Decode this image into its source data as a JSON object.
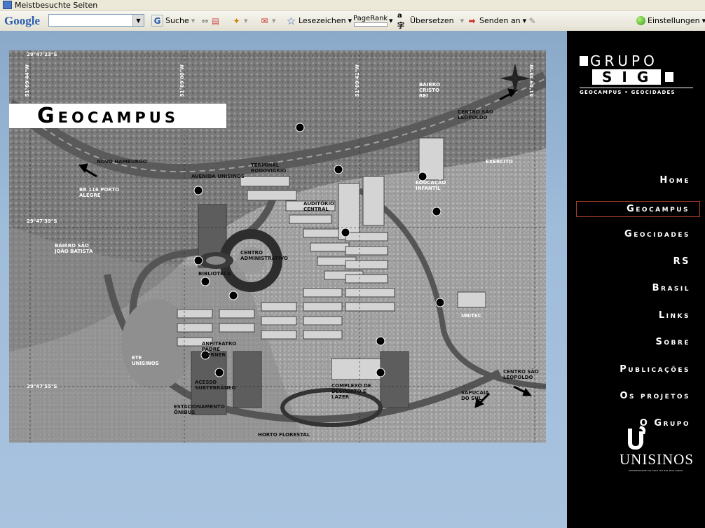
{
  "bookmarks_bar": {
    "item": "Meistbesuchte Seiten"
  },
  "google_toolbar": {
    "logo": "Google",
    "search_value": "",
    "search_label": "Suche",
    "bookmarks_label": "Lesezeichen",
    "pagerank_label": "PageRank",
    "translate_label": "Übersetzen",
    "send_label": "Senden an",
    "settings_label": "Einstellungen"
  },
  "brand": {
    "grupo": "GRUPO",
    "sig": "SIG",
    "subtitle": "GEOCAMPUS • GEOCIDADES"
  },
  "nav": {
    "home": "Home",
    "geocampus": "Geocampus",
    "geocidades": "Geocidades",
    "rs": "RS",
    "brasil": "Brasil",
    "links": "Links",
    "sobre": "Sobre",
    "publicacoes": "Publicações",
    "os_projetos": "Os projetos",
    "o_grupo": "O Grupo"
  },
  "university": {
    "name": "UNISINOS",
    "tagline": "UNIVERSIDADE DO VALE DO RIO DOS SINOS"
  },
  "map": {
    "title": "Geocampus",
    "coords": {
      "top_left": "29°47'23\"S",
      "mid_left": "29°47'39\"S",
      "bottom_left": "29°47'55\"S",
      "lon1": "51°09'44\"W",
      "lon2": "51°09'00\"W",
      "lon3": "51°09'41\"W",
      "lon4": "51°09'35\"W"
    },
    "labels": {
      "centro_administrativo": "CENTRO ADMINISTRATIVO",
      "novo_hamburgo": "NOVO HAMBURGO",
      "centro_sao_leopoldo": "CENTRO SÃO LEOPOLDO",
      "br116": "BR 116 PORTO ALEGRE",
      "complexo": "COMPLEXO DE DESPORTO E LAZER",
      "avenida": "AVENIDA UNISINOS",
      "bairro_sao_joao": "BAIRRO SÃO JOÃO BATISTA",
      "bairro_cristo_rei": "BAIRRO CRISTO REI",
      "exercito": "EXÉRCITO",
      "ete": "ETE UNISINOS",
      "estacionamento": "ESTACIONAMENTO ÔNIBUS",
      "horto": "HORTO FLORESTAL",
      "sapucaia": "SAPUCAIA DO SUL",
      "auditorio": "AUDITÓRIO CENTRAL",
      "biblioteca": "BIBLIOTECA",
      "anfiteatro": "ANFITEATRO PADRE WERNER",
      "unitec": "UNITEC",
      "terminal": "TERMINAL RODOVIÁRIO",
      "acesso": "ACESSO SUBTERRÂNEO",
      "educacao": "EDUCAÇÃO INFANTIL"
    }
  }
}
